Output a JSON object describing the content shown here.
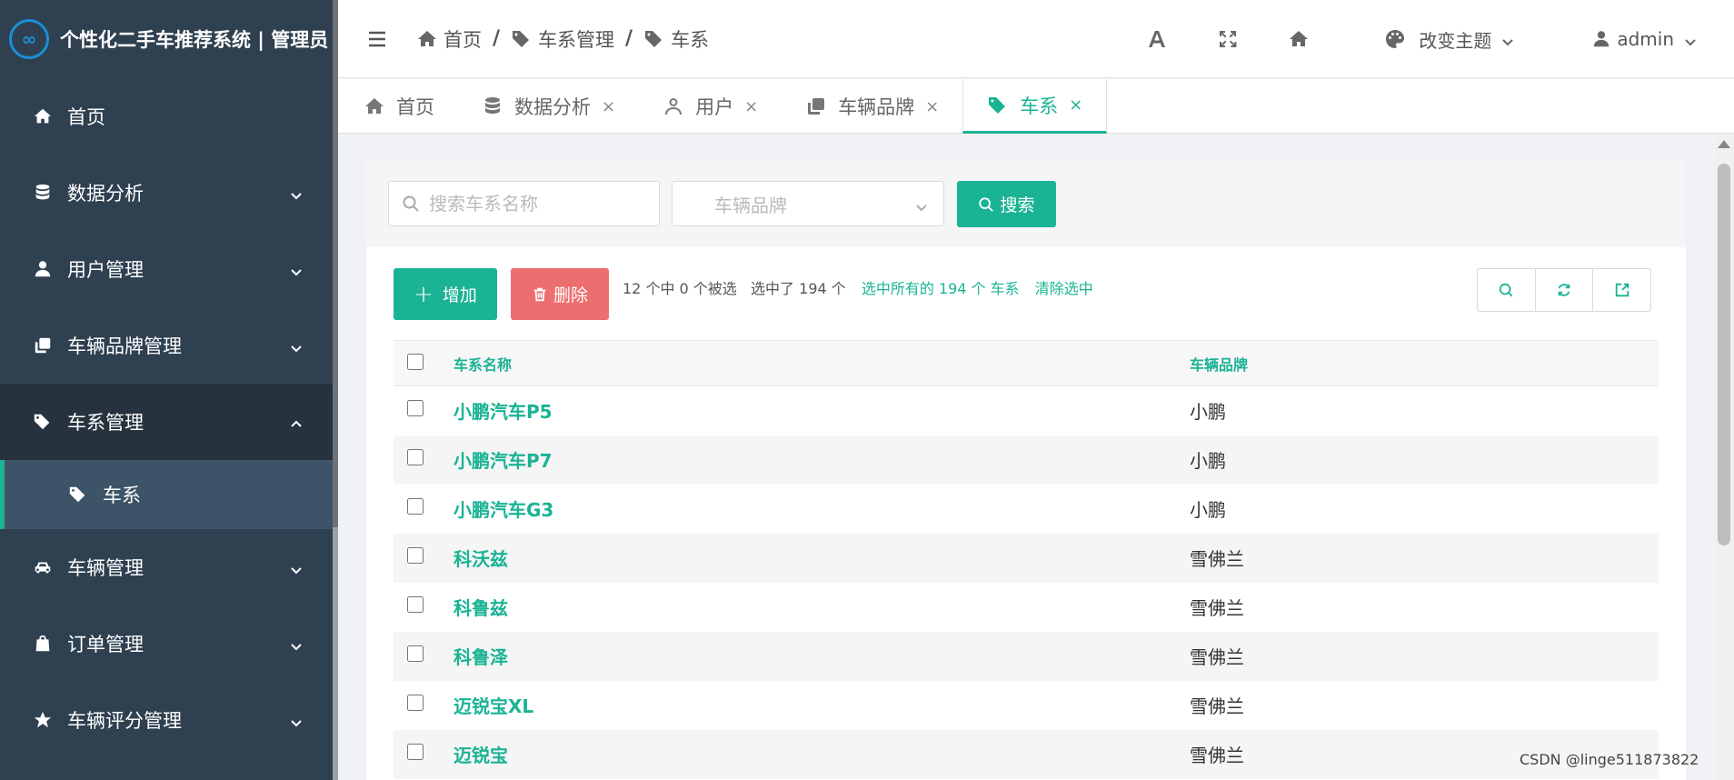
{
  "app": {
    "logo_text": "个性化二手车推荐系统 | 管理员",
    "logo_mark": "∞"
  },
  "sidebar": {
    "items": [
      {
        "label": "首页",
        "icon": "home-icon"
      },
      {
        "label": "数据分析",
        "icon": "database-icon"
      },
      {
        "label": "用户管理",
        "icon": "user-icon"
      },
      {
        "label": "车辆品牌管理",
        "icon": "copy-icon"
      },
      {
        "label": "车系管理",
        "icon": "tags-icon"
      },
      {
        "label": "车系",
        "icon": "tags-icon"
      },
      {
        "label": "车辆管理",
        "icon": "car-icon"
      },
      {
        "label": "订单管理",
        "icon": "shopping-bag-icon"
      },
      {
        "label": "车辆评分管理",
        "icon": "star-icon"
      }
    ]
  },
  "header": {
    "breadcrumb": [
      "首页",
      "车系管理",
      "车系"
    ],
    "breadcrumb_sep": "/",
    "theme_label": "改变主题",
    "user_label": "admin"
  },
  "tabs": [
    {
      "label": "首页",
      "close": ""
    },
    {
      "label": "数据分析",
      "close": "×"
    },
    {
      "label": "用户",
      "close": "×"
    },
    {
      "label": "车辆品牌",
      "close": "×"
    },
    {
      "label": "车系",
      "close": "×"
    }
  ],
  "search": {
    "placeholder": "搜索车系名称",
    "brand_placeholder": "车辆品牌",
    "button_label": "搜索"
  },
  "toolbar": {
    "add_label": "增加",
    "delete_label": "删除",
    "selection_info": "12 个中 0 个被选   选中了 194 个",
    "select_all_link": "选中所有的 194 个 车系",
    "clear_link": "清除选中"
  },
  "table": {
    "headers": [
      "车系名称",
      "车辆品牌"
    ],
    "rows": [
      {
        "name": "小鹏汽车P5",
        "brand": "小鹏"
      },
      {
        "name": "小鹏汽车P7",
        "brand": "小鹏"
      },
      {
        "name": "小鹏汽车G3",
        "brand": "小鹏"
      },
      {
        "name": "科沃兹",
        "brand": "雪佛兰"
      },
      {
        "name": "科鲁兹",
        "brand": "雪佛兰"
      },
      {
        "name": "科鲁泽",
        "brand": "雪佛兰"
      },
      {
        "name": "迈锐宝XL",
        "brand": "雪佛兰"
      },
      {
        "name": "迈锐宝",
        "brand": "雪佛兰"
      }
    ]
  },
  "watermark": "CSDN @linge511873822",
  "colors": {
    "accent": "#1ab394",
    "danger": "#ed6e6e",
    "sidebar_bg": "#2f4050"
  }
}
